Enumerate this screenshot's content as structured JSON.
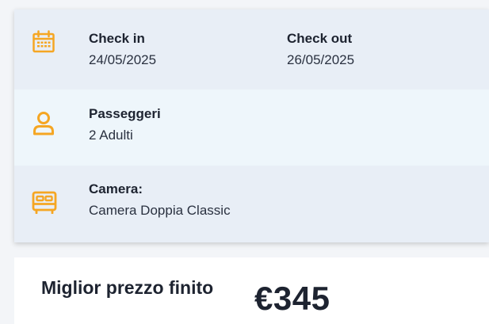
{
  "summary": {
    "check_in": {
      "label": "Check in",
      "value": "24/05/2025",
      "icon": "calendar-icon"
    },
    "check_out": {
      "label": "Check out",
      "value": "26/05/2025"
    },
    "passengers": {
      "label": "Passeggeri",
      "value": "2 Adulti",
      "icon": "person-icon"
    },
    "room": {
      "label": "Camera:",
      "value": "Camera Doppia Classic",
      "icon": "bed-icon"
    }
  },
  "price": {
    "label": "Miglior prezzo finito",
    "value": "€345"
  },
  "colors": {
    "accent": "#f5a623",
    "row_dark": "#e8eef6",
    "row_light": "#eef6fb"
  }
}
